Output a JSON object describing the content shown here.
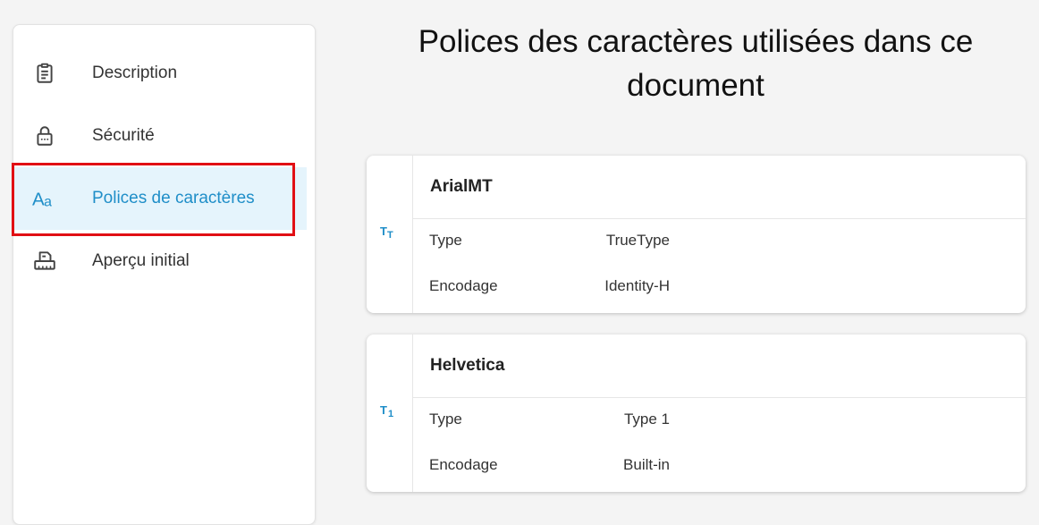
{
  "sidebar": {
    "items": [
      {
        "label": "Description",
        "icon": "clipboard-icon"
      },
      {
        "label": "Sécurité",
        "icon": "lock-icon"
      },
      {
        "label": "Polices de caractères",
        "icon": "font-aa-icon",
        "active": true
      },
      {
        "label": "Aperçu initial",
        "icon": "printer-icon"
      }
    ]
  },
  "main": {
    "title": "Polices des caractères utilisées dans ce document",
    "fonts": [
      {
        "name": "ArialMT",
        "icon": "truetype-icon",
        "type_label": "Type",
        "type_value": "TrueType",
        "encoding_label": "Encodage",
        "encoding_value": "Identity-H"
      },
      {
        "name": "Helvetica",
        "icon": "type1-icon",
        "type_label": "Type",
        "type_value": "Type 1",
        "encoding_label": "Encodage",
        "encoding_value": "Built-in"
      }
    ]
  },
  "colors": {
    "accent": "#1f8ec8",
    "active_bg": "#e5f4fc",
    "highlight_border": "#e10f14",
    "page_bg": "#f4f4f4"
  }
}
